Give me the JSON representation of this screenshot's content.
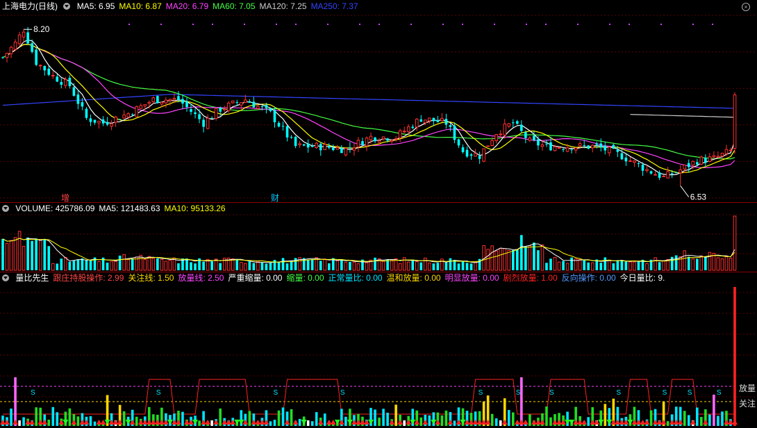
{
  "main_panel": {
    "title": "上海电力(日线)",
    "ma_labels": [
      {
        "text": "MA5: 6.95",
        "color": "#ffffff"
      },
      {
        "text": "MA10: 6.87",
        "color": "#ffff00"
      },
      {
        "text": "MA20: 6.79",
        "color": "#ff44ff"
      },
      {
        "text": "MA60: 7.05",
        "color": "#44ff44"
      },
      {
        "text": "MA120: 7.25",
        "color": "#cccccc"
      },
      {
        "text": "MA250: 7.37",
        "color": "#3344ff"
      }
    ],
    "high_label": "8.20",
    "low_label": "6.53",
    "events": [
      {
        "text": "增",
        "color": "#ff4444"
      },
      {
        "text": "财",
        "color": "#00c8ff"
      }
    ]
  },
  "volume_panel": {
    "labels": [
      {
        "text": "VOLUME: 425786.09",
        "color": "#ffffff"
      },
      {
        "text": "MA5: 121483.63",
        "color": "#ffffff"
      },
      {
        "text": "MA10: 95133.26",
        "color": "#ffff00"
      }
    ]
  },
  "indicator_panel": {
    "labels": [
      {
        "text": "量比先生",
        "color": "#ffffff"
      },
      {
        "text": "跟庄持股操作: 2.99",
        "color": "#ff4444"
      },
      {
        "text": "关注线: 1.50",
        "color": "#ffd700"
      },
      {
        "text": "放量线: 2.50",
        "color": "#ff44ff"
      },
      {
        "text": "严重缩量: 0.00",
        "color": "#ffffff"
      },
      {
        "text": "缩量: 0.00",
        "color": "#44ff44"
      },
      {
        "text": "正常量比: 0.00",
        "color": "#00e5ff"
      },
      {
        "text": "温和放量: 0.00",
        "color": "#ffd700"
      },
      {
        "text": "明显放量: 0.00",
        "color": "#ff44ff"
      },
      {
        "text": "剧烈放量: 1.00",
        "color": "#ff2222"
      },
      {
        "text": "反向操作: 0.00",
        "color": "#5599ff"
      },
      {
        "text": "今日量比: 9.",
        "color": "#ffffff"
      }
    ],
    "right_labels": {
      "fangliang": "放量",
      "guanzhu": "关注"
    },
    "signal_mark": "S"
  },
  "chart_data": {
    "type": "candlestick",
    "title": "上海电力(日线)",
    "y_range": [
      6.4,
      8.35
    ],
    "high": 8.2,
    "low": 6.53,
    "ma_current": {
      "MA5": 6.95,
      "MA10": 6.87,
      "MA20": 6.79,
      "MA60": 7.05,
      "MA120": 7.25,
      "MA250": 7.37
    },
    "volume_current": {
      "VOLUME": 425786.09,
      "MA5": 121483.63,
      "MA10": 95133.26
    },
    "indicator_lines": {
      "跟庄持股操作": 2.99,
      "关注线": 1.5,
      "放量线": 2.5
    },
    "indicator_current": {
      "严重缩量": 0.0,
      "缩量": 0.0,
      "正常量比": 0.0,
      "温和放量": 0.0,
      "明显放量": 0.0,
      "剧烈放量": 1.0,
      "反向操作": 0.0
    },
    "candle_count": 176
  }
}
